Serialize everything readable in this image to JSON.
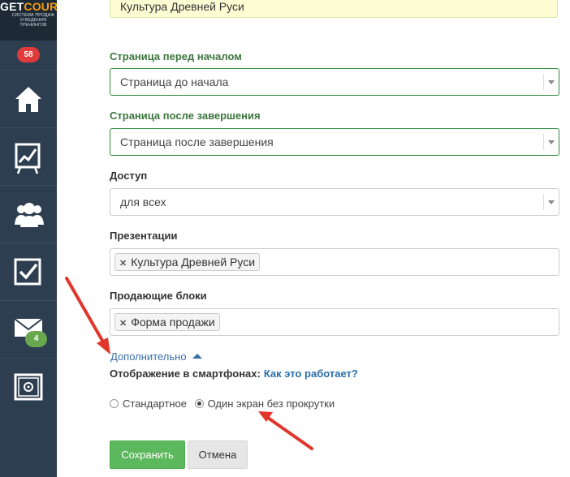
{
  "sidebar": {
    "logo": {
      "part1": "GET",
      "part2": "COURSE",
      "tagline": "Система продаж и ведения тренингов"
    },
    "notification_count": "58",
    "nav": [
      {
        "icon": "home-icon"
      },
      {
        "icon": "chart-easel-icon"
      },
      {
        "icon": "users-icon"
      },
      {
        "icon": "checkbox-icon"
      },
      {
        "icon": "mail-icon",
        "badge": "4"
      },
      {
        "icon": "safe-icon"
      }
    ]
  },
  "form": {
    "title_value": "Культура Древней Руси",
    "before_page": {
      "label": "Страница перед началом",
      "value": "Страница до начала"
    },
    "after_page": {
      "label": "Страница после завершения",
      "value": "Страница после завершения"
    },
    "access": {
      "label": "Доступ",
      "value": "для всех"
    },
    "presentations": {
      "label": "Презентации",
      "tags": [
        "Культура Древней Руси"
      ]
    },
    "sales_blocks": {
      "label": "Продающие блоки",
      "tags": [
        "Форма продажи"
      ]
    },
    "more_link": "Дополнительно",
    "smartphone": {
      "label": "Отображение в смартфонах:",
      "help_link": "Как это работает?",
      "options": [
        {
          "label": "Стандартное",
          "checked": false
        },
        {
          "label": "Один экран без прокрутки",
          "checked": true
        }
      ]
    },
    "save_label": "Сохранить",
    "cancel_label": "Отмена"
  },
  "colors": {
    "sidebar": "#2d3e50",
    "accent_green": "#5cb85c",
    "arrow_red": "#e0362c",
    "link_blue": "#2a6faa"
  }
}
